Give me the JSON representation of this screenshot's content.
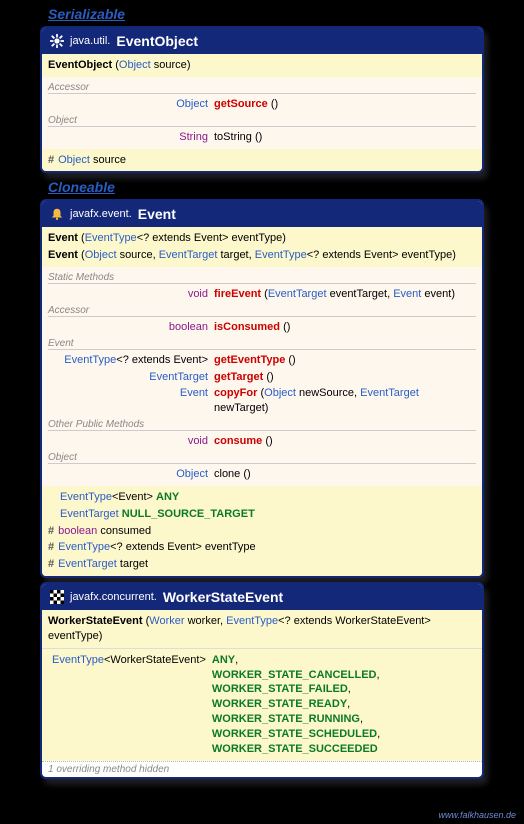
{
  "interfaces": {
    "serializable": "Serializable",
    "cloneable": "Cloneable"
  },
  "watermark": "www.falkhausen.de",
  "cards": [
    {
      "pkg": "java.util.",
      "cls": "EventObject",
      "ctor": [
        {
          "name": "EventObject",
          "params": [
            {
              "t": "Object",
              "n": "source"
            }
          ]
        }
      ],
      "groups": [
        {
          "title": "Accessor",
          "rows": [
            {
              "ret_type": "Object",
              "method": "getSource",
              "params": "()"
            }
          ]
        },
        {
          "title": "Object",
          "rows": [
            {
              "ret_prim": "String",
              "method_plain": "toString",
              "params": "()"
            }
          ]
        }
      ],
      "fields": [
        {
          "hash": true,
          "t": "Object",
          "n": "source"
        }
      ]
    },
    {
      "pkg": "javafx.event.",
      "cls": "Event",
      "ctor": [
        {
          "name": "Event",
          "params": [
            {
              "t": "EventType",
              "g": "<? extends Event>",
              "n": "eventType"
            }
          ]
        },
        {
          "name": "Event",
          "params": [
            {
              "t": "Object",
              "n": "source"
            },
            {
              "t": "EventTarget",
              "n": "target"
            },
            {
              "t": "EventType",
              "g": "<? extends Event>",
              "n": "eventType"
            }
          ]
        }
      ],
      "groups": [
        {
          "title": "Static Methods",
          "rows": [
            {
              "ret_prim": "void",
              "method": "fireEvent",
              "params_p": [
                {
                  "t": "EventTarget",
                  "n": "eventTarget"
                },
                {
                  "t": "Event",
                  "n": "event"
                }
              ]
            }
          ]
        },
        {
          "title": "Accessor",
          "rows": [
            {
              "ret_prim": "boolean",
              "method": "isConsumed",
              "params": "()"
            }
          ]
        },
        {
          "title": "Event",
          "rows": [
            {
              "ret_type": "EventType",
              "ret_g": "<? extends Event>",
              "method": "getEventType",
              "params": "()"
            },
            {
              "ret_type": "EventTarget",
              "method": "getTarget",
              "params": "()"
            },
            {
              "ret_type": "Event",
              "method": "copyFor",
              "params_p": [
                {
                  "t": "Object",
                  "n": "newSource"
                },
                {
                  "t": "EventTarget",
                  "n": "newTarget"
                }
              ]
            }
          ]
        },
        {
          "title": "Other Public Methods",
          "rows": [
            {
              "ret_prim": "void",
              "method": "consume",
              "params": "()"
            }
          ]
        },
        {
          "title": "Object",
          "rows": [
            {
              "ret_type": "Object",
              "method_plain": "clone",
              "params": "()"
            }
          ]
        }
      ],
      "public_consts": [
        {
          "t": "EventType",
          "g": "<Event>",
          "n": "ANY"
        },
        {
          "t": "EventTarget",
          "n": "NULL_SOURCE_TARGET"
        }
      ],
      "prot_fields": [
        {
          "prim": "boolean",
          "n": "consumed"
        },
        {
          "t": "EventType",
          "g": "<? extends Event>",
          "n": "eventType"
        },
        {
          "t": "EventTarget",
          "n": "target"
        }
      ]
    },
    {
      "pkg": "javafx.concurrent.",
      "cls": "WorkerStateEvent",
      "ctor": [
        {
          "name": "WorkerStateEvent",
          "params": [
            {
              "t": "Worker",
              "n": "worker"
            },
            {
              "t": "EventType",
              "g": "<? extends WorkerStateEvent>",
              "n": "eventType"
            }
          ]
        }
      ],
      "consts_type": {
        "t": "EventType",
        "g": "<WorkerStateEvent>"
      },
      "consts": [
        "ANY",
        "WORKER_STATE_CANCELLED",
        "WORKER_STATE_FAILED",
        "WORKER_STATE_READY",
        "WORKER_STATE_RUNNING",
        "WORKER_STATE_SCHEDULED",
        "WORKER_STATE_SUCCEEDED"
      ],
      "footer": "1 overriding method hidden"
    }
  ]
}
